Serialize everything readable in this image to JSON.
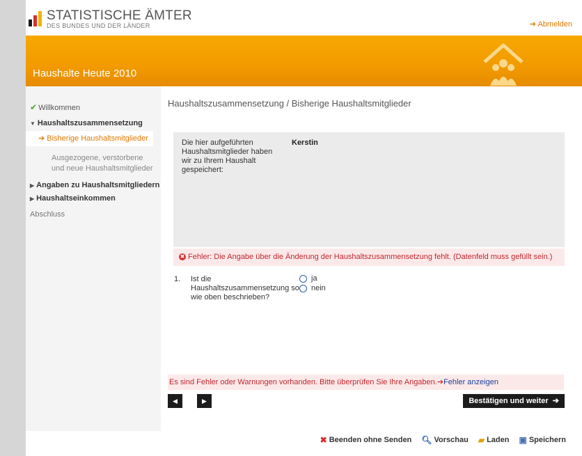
{
  "logo": {
    "line1": "STATISTISCHE ÄMTER",
    "line2": "DES BUNDES UND DER LÄNDER",
    "colors": [
      "#1c1c1c",
      "#d53030",
      "#f2b300"
    ]
  },
  "header": {
    "logout_label": "Abmelden"
  },
  "banner": {
    "title": "Haushalte Heute 2010",
    "icon": "house-family-icon"
  },
  "sidebar": {
    "items": [
      {
        "label": "Willkommen",
        "state": "done",
        "icon": "checkmark-icon"
      },
      {
        "label": "Haushaltszusammensetzung",
        "state": "expanded",
        "icon": "triangle-down-icon"
      },
      {
        "label": "Bisherige Haushaltsmitglieder",
        "state": "active",
        "icon": "arrow-right-icon"
      },
      {
        "label": "Ausgezogene, verstorbene und neue Haushaltsmitglieder",
        "state": "sub"
      },
      {
        "label": "Angaben zu Haushaltsmitgliedern",
        "state": "collapsed",
        "icon": "triangle-right-icon"
      },
      {
        "label": "Haushaltseinkommen",
        "state": "collapsed",
        "icon": "triangle-right-icon"
      },
      {
        "label": "Abschluss",
        "state": "plain"
      }
    ]
  },
  "main": {
    "heading": "Haushaltszusammensetzung / Bisherige Haushaltsmitglieder",
    "info_label": "Die hier aufgeführten Haushaltsmitglieder haben wir zu Ihrem Haushalt gespeichert:",
    "info_value": "Kerstin",
    "error": "Fehler: Die Angabe über die Änderung der Haushaltszusammensetzung fehlt. (Datenfeld muss gefüllt sein.)",
    "question": {
      "number": "1.",
      "text": "Ist die Haushaltszusammensetzung so, wie oben beschrieben?",
      "options": [
        "ja",
        "nein"
      ]
    },
    "warning": "Es sind Fehler oder Warnungen vorhanden. Bitte überprüfen Sie Ihre Angaben.",
    "warning_link": "Fehler anzeigen",
    "confirm_label": "Bestätigen und weiter"
  },
  "footer": {
    "buttons": [
      {
        "label": "Beenden ohne Senden",
        "icon": "red-x-icon"
      },
      {
        "label": "Vorschau",
        "icon": "magnifier-icon"
      },
      {
        "label": "Laden",
        "icon": "folder-icon"
      },
      {
        "label": "Speichern",
        "icon": "floppy-disk-icon"
      }
    ]
  },
  "colors": {
    "accent": "#f29a00",
    "error": "#c1272d",
    "link": "#1a3f9e"
  }
}
